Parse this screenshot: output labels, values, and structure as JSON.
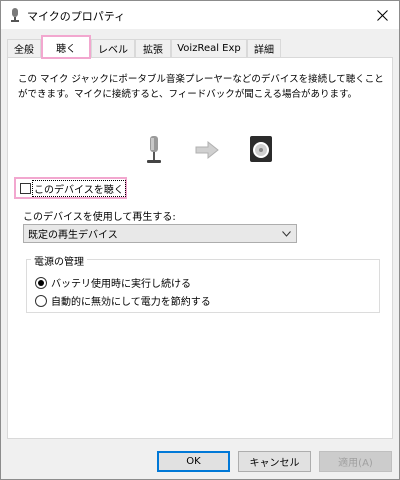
{
  "window": {
    "title": "マイクのプロパティ"
  },
  "tabs": [
    {
      "label": "全般"
    },
    {
      "label": "聴く"
    },
    {
      "label": "レベル"
    },
    {
      "label": "拡張"
    },
    {
      "label": "VoizReal Exp"
    },
    {
      "label": "詳細"
    }
  ],
  "listen": {
    "description": "この マイク ジャックにポータブル音楽プレーヤーなどのデバイスを接続して聴くことができます。マイクに接続すると、フィードバックが聞こえる場合があります。",
    "checkbox_label": "このデバイスを聴く",
    "checkbox_checked": false,
    "playback_label": "このデバイスを使用して再生する:",
    "playback_value": "既定の再生デバイス"
  },
  "power": {
    "group_title": "電源の管理",
    "options": [
      {
        "label": "バッテリ使用時に実行し続ける",
        "selected": true
      },
      {
        "label": "自動的に無効にして電力を節約する",
        "selected": false
      }
    ]
  },
  "buttons": {
    "ok": "OK",
    "cancel": "キャンセル",
    "apply": "適用(A)"
  },
  "colors": {
    "highlight": "#f2a7cf",
    "default_button_border": "#0078d7"
  }
}
